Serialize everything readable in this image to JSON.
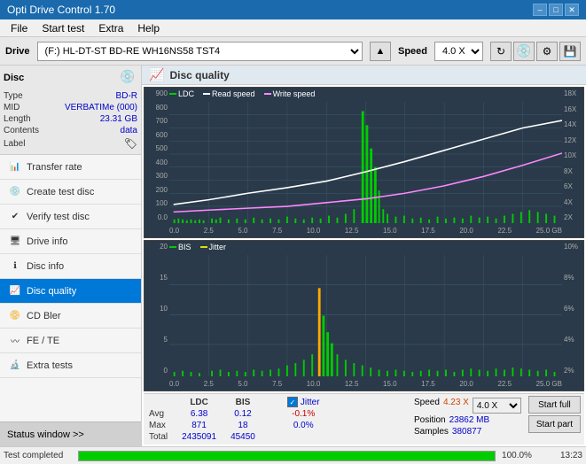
{
  "titleBar": {
    "title": "Opti Drive Control 1.70",
    "minimizeBtn": "–",
    "maximizeBtn": "□",
    "closeBtn": "✕"
  },
  "menuBar": {
    "items": [
      "File",
      "Start test",
      "Extra",
      "Help"
    ]
  },
  "driveBar": {
    "driveLabel": "Drive",
    "driveValue": "(F:)  HL-DT-ST BD-RE  WH16NS58 TST4",
    "speedLabel": "Speed",
    "speedValue": "4.0 X"
  },
  "sidebar": {
    "discSection": {
      "title": "Disc",
      "typeLabel": "Type",
      "typeValue": "BD-R",
      "midLabel": "MID",
      "midValue": "VERBATIMe (000)",
      "lengthLabel": "Length",
      "lengthValue": "23.31 GB",
      "contentsLabel": "Contents",
      "contentsValue": "data",
      "labelLabel": "Label",
      "labelValue": ""
    },
    "menuItems": [
      {
        "id": "transfer-rate",
        "label": "Transfer rate",
        "active": false
      },
      {
        "id": "create-test-disc",
        "label": "Create test disc",
        "active": false
      },
      {
        "id": "verify-test-disc",
        "label": "Verify test disc",
        "active": false
      },
      {
        "id": "drive-info",
        "label": "Drive info",
        "active": false
      },
      {
        "id": "disc-info",
        "label": "Disc info",
        "active": false
      },
      {
        "id": "disc-quality",
        "label": "Disc quality",
        "active": true
      },
      {
        "id": "cd-bler",
        "label": "CD Bler",
        "active": false
      },
      {
        "id": "fe-te",
        "label": "FE / TE",
        "active": false
      },
      {
        "id": "extra-tests",
        "label": "Extra tests",
        "active": false
      }
    ],
    "statusWindow": "Status window >>"
  },
  "content": {
    "title": "Disc quality",
    "chart1": {
      "legend": [
        "LDC",
        "Read speed",
        "Write speed"
      ],
      "yAxisLeft": [
        "900",
        "800",
        "700",
        "600",
        "500",
        "400",
        "300",
        "200",
        "100",
        "0.0"
      ],
      "yAxisRight": [
        "18X",
        "16X",
        "14X",
        "12X",
        "10X",
        "8X",
        "6X",
        "4X",
        "2X"
      ],
      "xAxis": [
        "0.0",
        "2.5",
        "5.0",
        "7.5",
        "10.0",
        "12.5",
        "15.0",
        "17.5",
        "20.0",
        "22.5",
        "25.0 GB"
      ]
    },
    "chart2": {
      "legend": [
        "BIS",
        "Jitter"
      ],
      "yAxisLeft": [
        "20",
        "15",
        "10",
        "5",
        "0"
      ],
      "yAxisRight": [
        "10%",
        "8%",
        "6%",
        "4%",
        "2%"
      ],
      "xAxis": [
        "0.0",
        "2.5",
        "5.0",
        "7.5",
        "10.0",
        "12.5",
        "15.0",
        "17.5",
        "20.0",
        "22.5",
        "25.0 GB"
      ]
    },
    "stats": {
      "headers": [
        "",
        "LDC",
        "BIS",
        "",
        "Jitter",
        "Speed",
        ""
      ],
      "rows": [
        {
          "label": "Avg",
          "ldc": "6.38",
          "bis": "0.12",
          "jitter": "-0.1%",
          "speed": "4.23 X",
          "speedTarget": "4.0 X"
        },
        {
          "label": "Max",
          "ldc": "871",
          "bis": "18",
          "jitter": "0.0%",
          "position": "23862 MB"
        },
        {
          "label": "Total",
          "ldc": "2435091",
          "bis": "45450",
          "samples": "380877"
        }
      ],
      "jitterLabel": "Jitter",
      "speedLabel": "Speed",
      "speedVal": "4.23 X",
      "speedTarget": "4.0 X",
      "positionLabel": "Position",
      "positionVal": "23862 MB",
      "samplesLabel": "Samples",
      "samplesVal": "380877",
      "startFullBtn": "Start full",
      "startPartBtn": "Start part"
    }
  },
  "bottomStatus": {
    "statusText": "Test completed",
    "progressPct": "100.0%",
    "timeText": "13:23"
  },
  "colors": {
    "ldcBar": "#00cc00",
    "bisBar": "#00cc00",
    "readSpeed": "#ffffff",
    "writeSpeed": "#ff00ff",
    "jitter": "#ffff00",
    "chartBg": "#2a3a4a",
    "activeMenu": "#0078d7"
  }
}
